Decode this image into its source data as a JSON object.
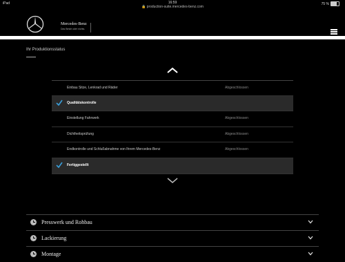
{
  "statusbar": {
    "device": "iPad",
    "time": "16:59",
    "url": "production-suite.mercedes-benz.com",
    "battery": "75 %"
  },
  "header": {
    "brand": "Mercedes-Benz",
    "tagline": "Das Beste oder nichts."
  },
  "section": {
    "title": "Ihr Produktionsstatus"
  },
  "steps": [
    {
      "label": "Einbau Sitze, Lenkrad und Räder",
      "status": "Abgeschlossen",
      "active": false
    },
    {
      "label": "Qualitätskontrolle",
      "status": "",
      "active": true
    },
    {
      "label": "Einstellung Fahrwerk",
      "status": "Abgeschlossen",
      "active": false
    },
    {
      "label": "Dichtheitsprüfung",
      "status": "Abgeschlossen",
      "active": false
    },
    {
      "label": "Endkontrolle und Schlußabnahme von Ihrem Mercedes-Benz",
      "status": "Abgeschlossen",
      "active": false
    },
    {
      "label": "Fertiggestellt",
      "status": "",
      "active": true
    }
  ],
  "accordion": [
    {
      "label": "Presswerk und Rohbau"
    },
    {
      "label": "Lackierung"
    },
    {
      "label": "Montage"
    }
  ],
  "colors": {
    "background": "#000000",
    "active_row": "#2a2a2a",
    "check": "#3aa0dc"
  }
}
